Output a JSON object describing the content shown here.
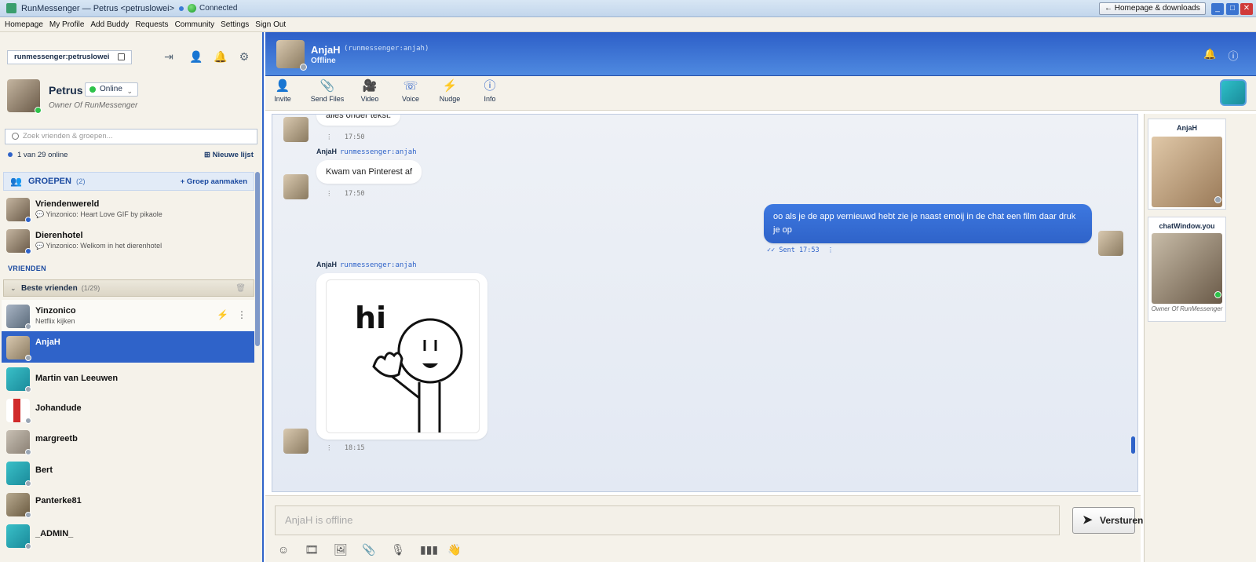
{
  "titlebar": {
    "title": "RunMessenger — Petrus <petruslowei>",
    "connection": "Connected",
    "homepage_button": "← Homepage & downloads"
  },
  "menu": [
    "Homepage",
    "My Profile",
    "Add Buddy",
    "Requests",
    "Community",
    "Settings",
    "Sign Out"
  ],
  "sidebar": {
    "user_id": "runmessenger:petruslowei",
    "profile": {
      "name": "Petrus",
      "status": "Online",
      "subtitle": "Owner Of RunMessenger"
    },
    "search_placeholder": "Zoek vrienden & groepen...",
    "online_count": "1 van 29 online",
    "new_list": "Nieuwe lijst",
    "groups_title": "GROEPEN",
    "groups_count": "(2)",
    "add_group": "+ Groep aanmaken",
    "groups": [
      {
        "name": "Vriendenwereld",
        "last": "💬 Yinzonico: Heart Love GIF by pikaole"
      },
      {
        "name": "Dierenhotel",
        "last": "💬 Yinzonico: Welkom in het dierenhotel"
      }
    ],
    "friends_title": "VRIENDEN",
    "best_friends": {
      "title": "Beste vrienden",
      "count": "(1/29)"
    },
    "contacts": [
      {
        "name": "Yinzonico",
        "sub": "Netflix kijken"
      },
      {
        "name": "AnjaH",
        "sub": ""
      },
      {
        "name": "Martin van Leeuwen",
        "sub": ""
      },
      {
        "name": "Johandude",
        "sub": ""
      },
      {
        "name": "margreetb",
        "sub": ""
      },
      {
        "name": "Bert",
        "sub": ""
      },
      {
        "name": "Panterke81",
        "sub": ""
      },
      {
        "name": "_ADMIN_",
        "sub": ""
      }
    ]
  },
  "chat": {
    "contact_name": "AnjaH",
    "contact_id": "(runmessenger:anjah)",
    "contact_status": "Offline",
    "toolbar": [
      "Invite",
      "Send Files",
      "Video",
      "Voice",
      "Nudge",
      "Info"
    ],
    "messages": [
      {
        "text": "alles onder tekst.",
        "time": "17:50"
      },
      {
        "sender": "AnjaH",
        "sender_id": "runmessenger:anjah",
        "text": "Kwam van Pinterest af",
        "time": "17:50"
      },
      {
        "text": "oo als je de app vernieuwd hebt zie je naast emoij in de chat een film daar druk je op",
        "status": "Sent",
        "time": "17:53"
      },
      {
        "sender": "AnjaH",
        "sender_id": "runmessenger:anjah",
        "gif_text": "hi",
        "time": "18:15"
      }
    ],
    "input_placeholder": "AnjaH is offline",
    "send_label": "Versturen"
  },
  "right_panel": {
    "cards": [
      {
        "name": "AnjaH",
        "sub": ""
      },
      {
        "name": "chatWindow.you",
        "sub": "Owner Of RunMessenger"
      }
    ]
  },
  "colors": {
    "accent": "#2f63c9",
    "online": "#2ec24a",
    "offline": "#9aa6b4"
  }
}
